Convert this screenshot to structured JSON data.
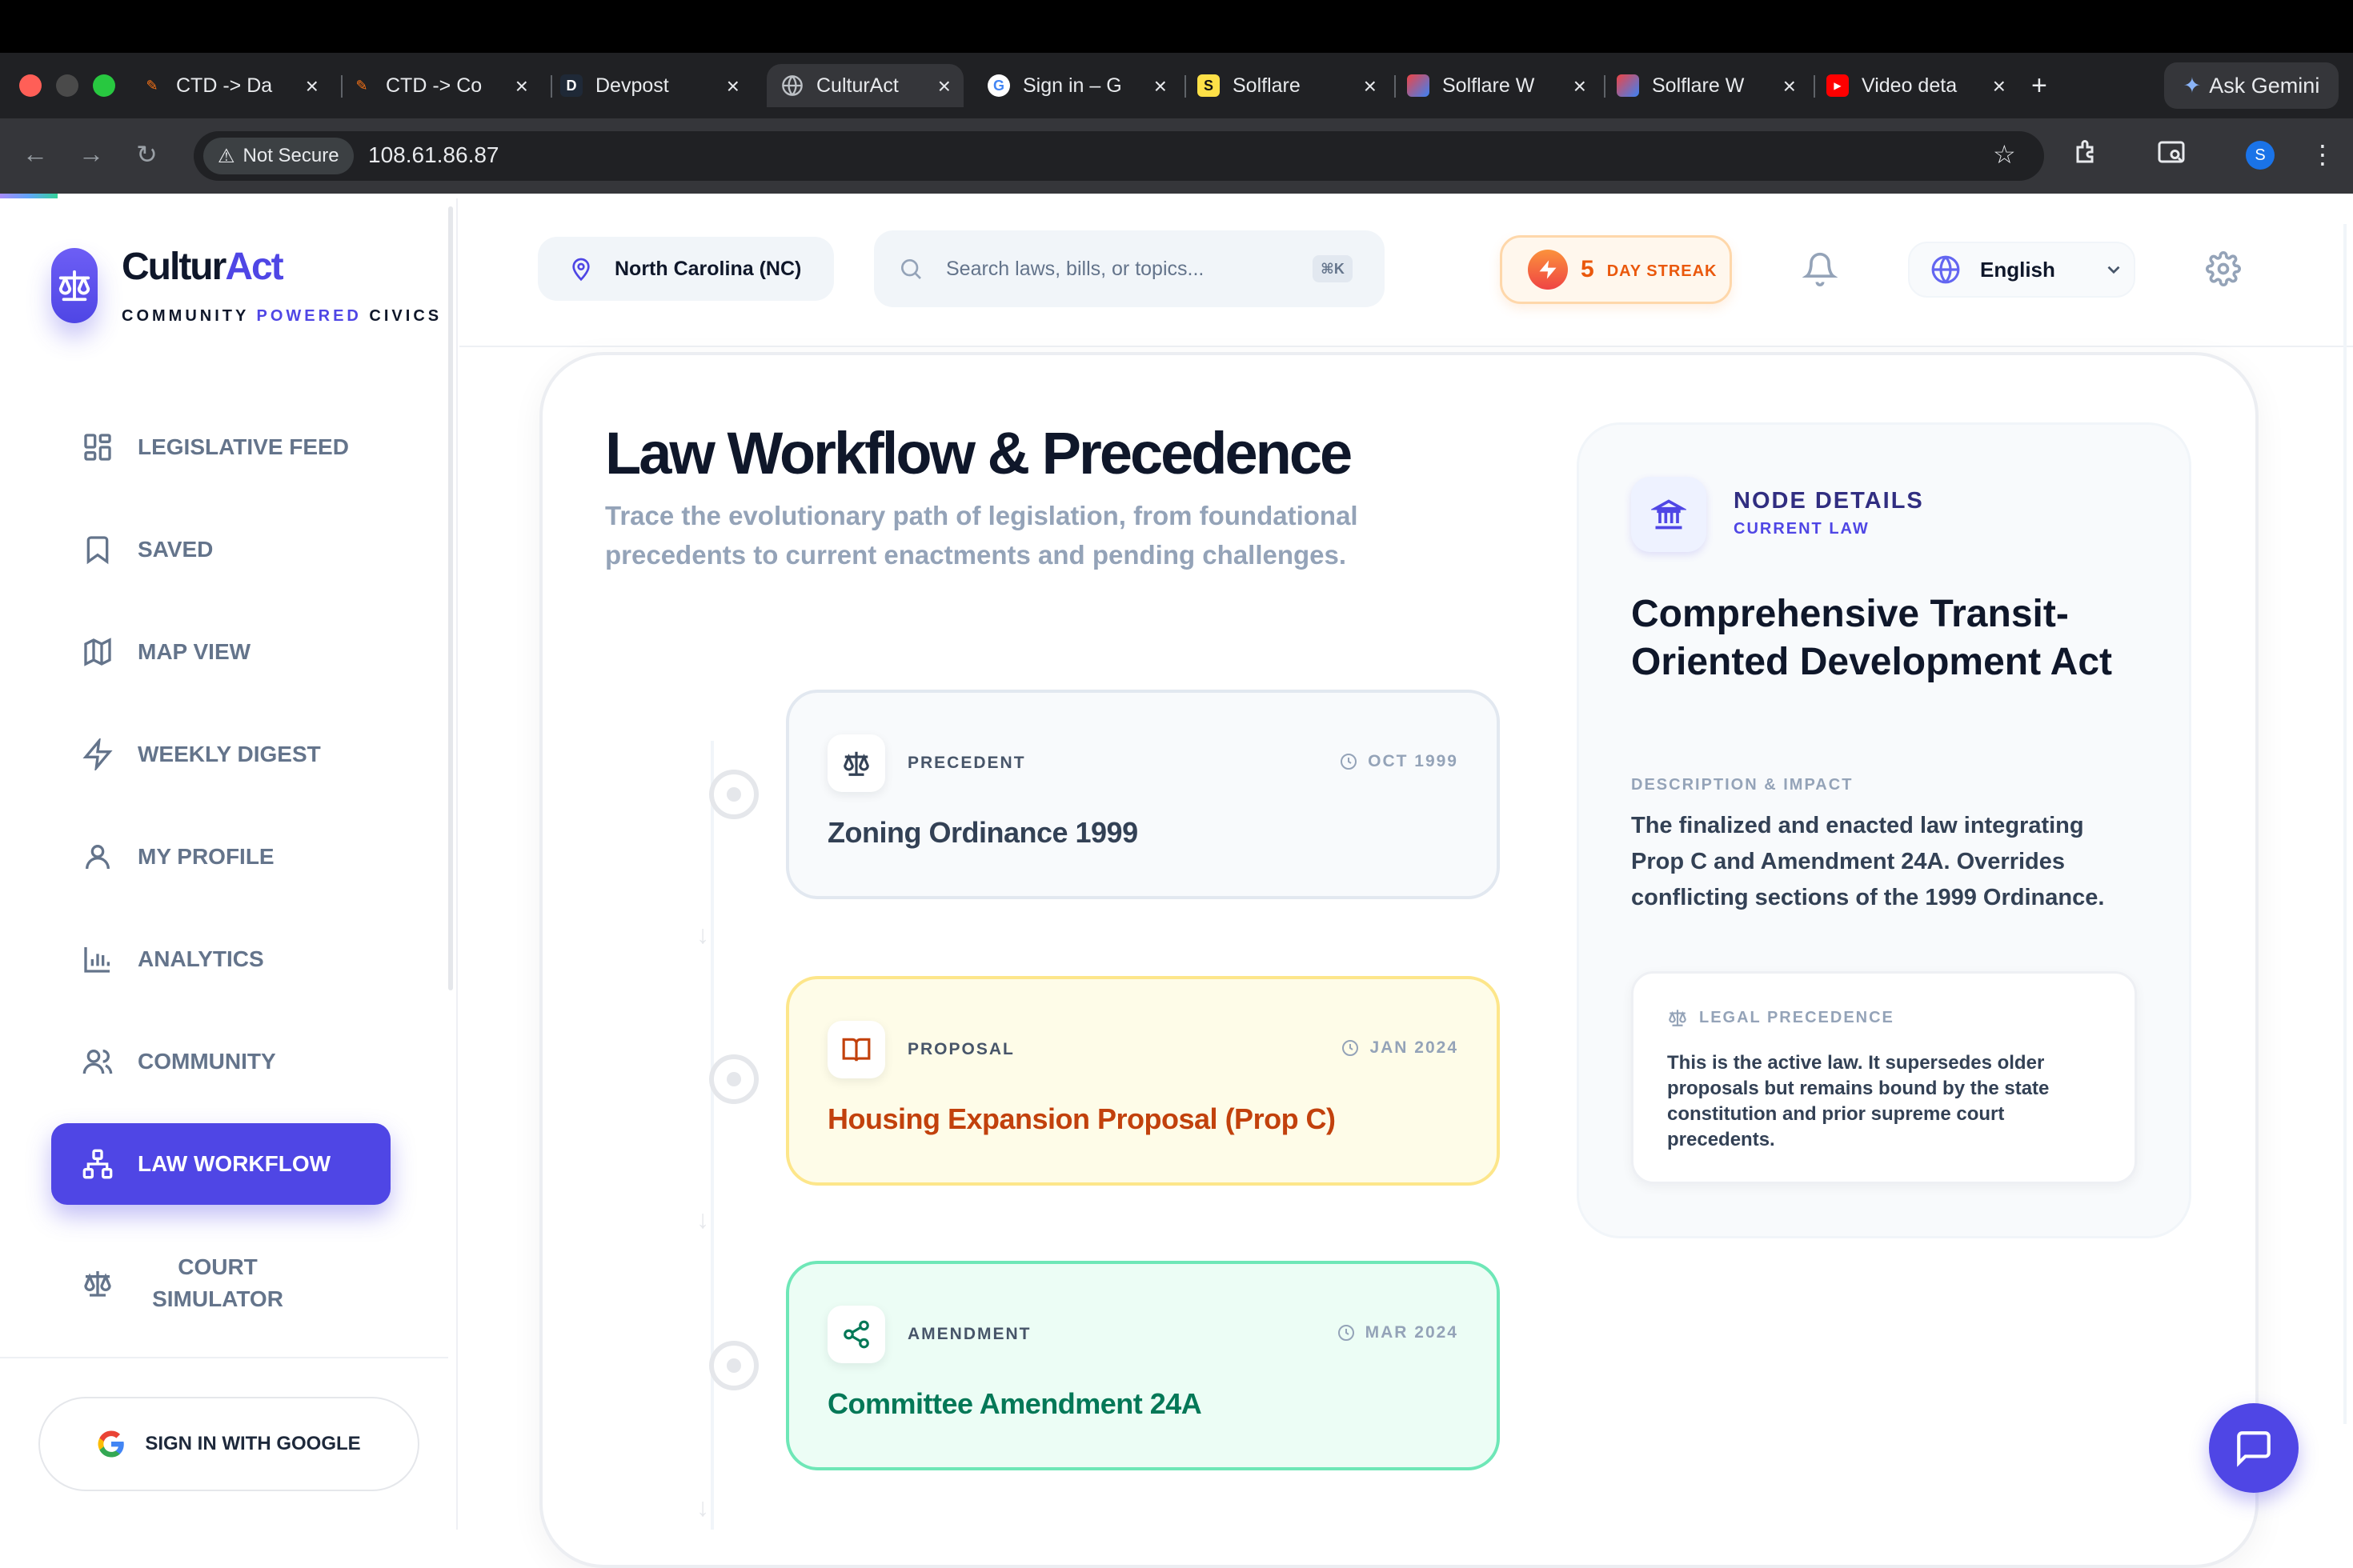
{
  "browser": {
    "tabs": [
      {
        "title": "CTD -> Da",
        "icon": "pen-favicon"
      },
      {
        "title": "CTD -> Co",
        "icon": "pen-favicon"
      },
      {
        "title": "Devpost",
        "icon": "devpost-favicon",
        "glyph": "D"
      },
      {
        "title": "CulturAct",
        "icon": "globe-favicon"
      },
      {
        "title": "Sign in – G",
        "icon": "google-favicon",
        "glyph": "G"
      },
      {
        "title": "Solflare",
        "icon": "solflare-favicon",
        "glyph": "S"
      },
      {
        "title": "Solflare W",
        "icon": "solflare-wallet-favicon"
      },
      {
        "title": "Solflare W",
        "icon": "solflare-wallet-favicon"
      },
      {
        "title": "Video deta",
        "icon": "youtube-favicon"
      }
    ],
    "new_tab": "+",
    "ask_gemini": "Ask Gemini",
    "not_secure": "Not Secure",
    "url": "108.61.86.87",
    "profile_initial": "S"
  },
  "brand": {
    "name_a": "Cultur",
    "name_b": "Act",
    "tag_a": "COMMUNITY ",
    "tag_b": "POWERED",
    "tag_c": " CIVICS",
    "accent": "#4f46e5"
  },
  "sidebar": {
    "items": [
      {
        "label": "LEGISLATIVE FEED",
        "icon": "grid-icon"
      },
      {
        "label": "SAVED",
        "icon": "bookmark-icon"
      },
      {
        "label": "MAP VIEW",
        "icon": "map-icon"
      },
      {
        "label": "WEEKLY DIGEST",
        "icon": "lightning-icon"
      },
      {
        "label": "MY PROFILE",
        "icon": "user-icon"
      },
      {
        "label": "ANALYTICS",
        "icon": "bar-chart-icon"
      },
      {
        "label": "COMMUNITY",
        "icon": "users-icon"
      },
      {
        "label": "LAW WORKFLOW",
        "icon": "workflow-icon",
        "active": true
      },
      {
        "label_1": "COURT",
        "label_2": "SIMULATOR",
        "icon": "scale-icon"
      }
    ],
    "sign_in": "SIGN IN WITH GOOGLE"
  },
  "header": {
    "state": "North Carolina (NC)",
    "search_placeholder": "Search laws, bills, or topics...",
    "search_shortcut": "⌘K",
    "streak_count": "5",
    "streak_label": "DAY STREAK",
    "language": "English"
  },
  "main": {
    "title": "Law Workflow & Precedence",
    "subtitle": "Trace the evolutionary path of legislation, from foundational precedents to current enactments and pending challenges.",
    "nodes": [
      {
        "kind": "PRECEDENT",
        "date": "OCT 1999",
        "title": "Zoning Ordinance 1999",
        "icon": "scale-icon",
        "color": "#334155"
      },
      {
        "kind": "PROPOSAL",
        "date": "JAN 2024",
        "title": "Housing Expansion Proposal (Prop C)",
        "icon": "book-icon",
        "color": "#c2410c"
      },
      {
        "kind": "AMENDMENT",
        "date": "MAR 2024",
        "title": "Committee Amendment 24A",
        "icon": "share-icon",
        "color": "#047857"
      }
    ]
  },
  "details": {
    "heading": "NODE DETAILS",
    "subheading": "CURRENT LAW",
    "title": "Comprehensive Transit-Oriented Development Act",
    "desc_label": "DESCRIPTION & IMPACT",
    "description": "The finalized and enacted law integrating Prop C and Amendment 24A. Overrides conflicting sections of the 1999 Ordinance.",
    "precedence_label": "LEGAL PRECEDENCE",
    "precedence_text": "This is the active law. It supersedes older proposals but remains bound by the state constitution and prior supreme court precedents."
  }
}
